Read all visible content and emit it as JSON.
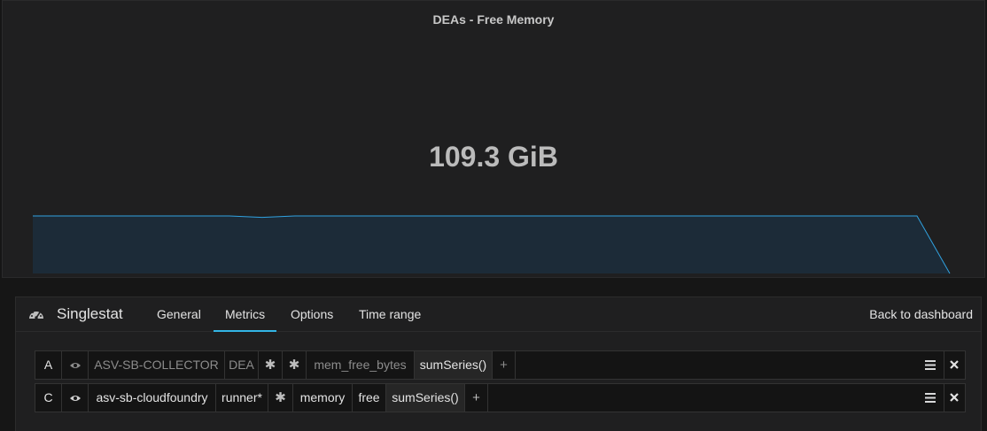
{
  "panel": {
    "title": "DEAs - Free Memory",
    "value": "109.3 GiB",
    "sparkline": [
      0.81,
      0.81,
      0.81,
      0.81,
      0.81,
      0.81,
      0.81,
      0.79,
      0.81,
      0.81,
      0.81,
      0.81,
      0.81,
      0.81,
      0.81,
      0.81,
      0.81,
      0.81,
      0.81,
      0.81,
      0.81,
      0.81,
      0.81,
      0.81,
      0.81,
      0.81,
      0.81,
      0.81,
      0.0
    ],
    "colors": {
      "line": "#31a2e0",
      "fill": "#1c2b38"
    }
  },
  "editor": {
    "icon": "dashboard-gauge-icon",
    "title": "Singlestat",
    "tabs": [
      {
        "label": "General"
      },
      {
        "label": "Metrics"
      },
      {
        "label": "Options"
      },
      {
        "label": "Time range"
      }
    ],
    "active_tab": "Metrics",
    "back_label": "Back to dashboard",
    "accent": "#33b5e5"
  },
  "queries": [
    {
      "ref": "A",
      "segments": [
        "ASV-SB-COLLECTOR",
        "DEA",
        "✱",
        "✱",
        "mem_free_bytes"
      ],
      "function": "sumSeries()",
      "add": "+",
      "enabled": false
    },
    {
      "ref": "C",
      "segments": [
        "asv-sb-cloudfoundry",
        "runner*",
        "✱",
        "memory",
        "free"
      ],
      "function": "sumSeries()",
      "add": "+",
      "enabled": true
    }
  ]
}
